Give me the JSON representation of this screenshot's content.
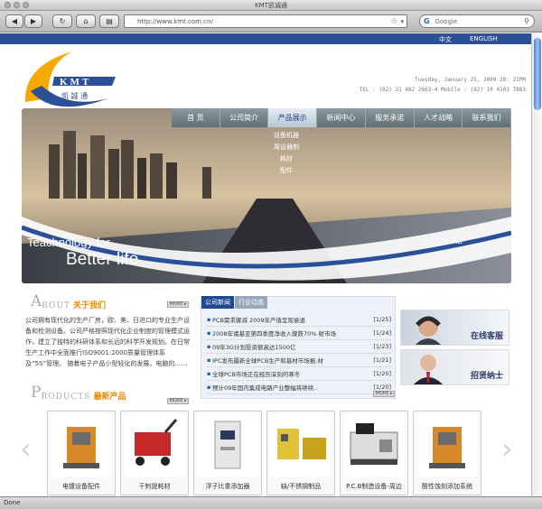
{
  "browser": {
    "window_title": "KMT凯诚通",
    "address": "http://www.kmt.com.cn/",
    "search_placeholder": "Google",
    "status": "Done"
  },
  "lang": {
    "cn": "中文",
    "en": "ENGLISH"
  },
  "brand": {
    "logo_text": "KMT",
    "logo_cn": "凯诚通",
    "accent": "#f5a800",
    "blue": "#2b4f98"
  },
  "header": {
    "date": "Tuesday, January 25, 2009 20: 21PM",
    "contact": "TEL : (82) 31 482 2663-4  Mobile : (82) 10 4103 7883"
  },
  "nav": {
    "items": [
      "首 页",
      "公司简介",
      "产品展示",
      "新闻中心",
      "服务承诺",
      "人才战略",
      "联系我们"
    ],
    "submenu": [
      "设备机器",
      "周设器制",
      "耗材",
      "配件"
    ]
  },
  "banner": {
    "tag1": "Teachnology for",
    "tag2": "Better life",
    "watermark": "EAS"
  },
  "about": {
    "big": "A",
    "en": "BOUT",
    "cn": "关于我们",
    "more": "MORE ▸",
    "text": "公司拥有现代化的生产厂房，欧、美、日进口的专业生产设备和检测设备。公司严格按照现代化企业制度的管理模式运作，建立了独特的科研体系和长远的科学开发规划。在日常生产工作中全面推行ISO9001:2000质量管理体系及“5S”管理。 随着电子产品小型轻化的发展，电脑的……"
  },
  "news": {
    "tabs": [
      "公司新闻",
      "行业动态"
    ],
    "items": [
      {
        "title": "PCB需求骤减 2009年产值呈现衰退",
        "date": "[1/25]"
      },
      {
        "title": "2008年诸基亚第四季度净收入骤跌70% 射市场",
        "date": "[1/24]"
      },
      {
        "title": "09年3G计划投资额高达1500亿",
        "date": "[1/23]"
      },
      {
        "title": "IPC发布最新全球PCB生产和基材市场报.材",
        "date": "[1/21]"
      },
      {
        "title": "全球PCB市场正在经历深刻的寒冬",
        "date": "[1/20]"
      },
      {
        "title": "预计09年国内集成电路产业整幅将继续..",
        "date": "[1/20]"
      }
    ],
    "more": "MORE ▸"
  },
  "side": {
    "service": "在线客服",
    "hiring": "招贤纳士"
  },
  "products": {
    "big": "P",
    "en": "RODUCTS",
    "cn": "最新产品",
    "more": "MORE ▸",
    "items": [
      "电镀设备配件",
      "干刺提耗材",
      "浮子比重添加器",
      "缺/不锈钢制品",
      "P.C.B制造设备-周边",
      "酸性蚀刻添加系统"
    ]
  }
}
